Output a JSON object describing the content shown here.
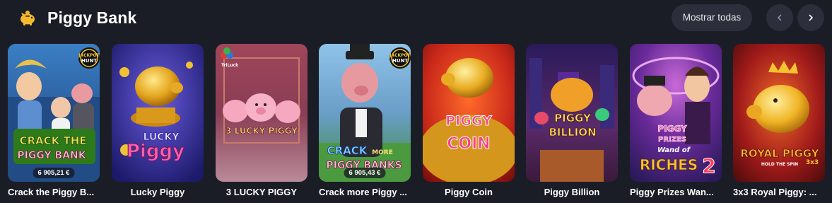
{
  "section": {
    "icon": "piggy-bank-icon",
    "title": "Piggy Bank",
    "show_all_label": "Mostrar todas",
    "prev_icon": "chevron-left-icon",
    "next_icon": "chevron-right-icon"
  },
  "games": [
    {
      "label": "Crack the Piggy B...",
      "jackpot": "6 905,21 €",
      "badge": "JACKPOT HUNT",
      "logo": "CRACK THE PIGGY BANK"
    },
    {
      "label": "Lucky Piggy",
      "logo": "LUCKY PIGGY"
    },
    {
      "label": "3 LUCKY PIGGY",
      "provider": "TriLuck",
      "logo": "3 LUCKY PIGGY"
    },
    {
      "label": "Crack more Piggy ...",
      "jackpot": "6 905,43 €",
      "badge": "JACKPOT HUNT",
      "logo": "CRACK MORE PIGGY BANKS"
    },
    {
      "label": "Piggy Coin",
      "logo": "PIGGY COIN"
    },
    {
      "label": "Piggy Billion",
      "logo": "PIGGY BILLION"
    },
    {
      "label": "Piggy Prizes Wan...",
      "logo": "PIGGY PRIZES Wand of RICHES 2"
    },
    {
      "label": "3x3 Royal Piggy: ...",
      "logo": "ROYAL PIGGY",
      "sublogo": "HOLD THE SPIN 3x3"
    }
  ],
  "colors": {
    "background": "#1b1d26",
    "button": "#2c2f3b",
    "text": "#ffffff"
  }
}
